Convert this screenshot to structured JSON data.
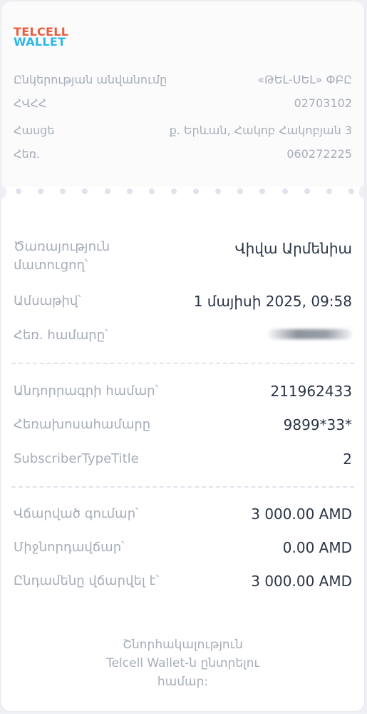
{
  "brand": {
    "line1": "TELCELL",
    "line2": "WALLET"
  },
  "company": [
    {
      "label": "Ընկերության անվանումը",
      "value": "«ԹԵԼ-ՍԵԼ» ՓԲԸ"
    },
    {
      "label": "ՀՎՀՀ",
      "value": "02703102"
    },
    {
      "label": "Հասցե",
      "value": "ք. Երևան, Հակոբ Հակոբյան 3"
    },
    {
      "label": "Հեռ.",
      "value": "060272225"
    }
  ],
  "provider": {
    "label_line1": "Ծառայություն",
    "label_line2": "մատուցող՝",
    "value": "Վիվա Արմենիա"
  },
  "date": {
    "label": "Ամսաթիվ՝",
    "value": "1 մայիսի 2025, 09:58"
  },
  "phone": {
    "label": "Հեռ. համարը՝"
  },
  "details": [
    {
      "label": "Անդորրագրի համար՝",
      "value": "211962433"
    },
    {
      "label": "Հեռախոսահամարը",
      "value": "9899*33*"
    },
    {
      "label": "SubscriberTypeTitle",
      "value": "2"
    }
  ],
  "payment": [
    {
      "label": "Վճարված գումար՝",
      "value": "3 000.00 AMD"
    },
    {
      "label": "Միջնորդավճար՝",
      "value": "0.00 AMD"
    },
    {
      "label": "Ընդամենը վճարվել է՝",
      "value": "3 000.00 AMD"
    }
  ],
  "thanks": {
    "line1": "Շնորհակալություն",
    "line2": "Telcell Wallet-ն ընտրելու",
    "line3": "համար:"
  },
  "colors": {
    "brand_red": "#ef5a3c",
    "brand_blue": "#2bb7e8",
    "text_dark": "#2a3446",
    "text_muted": "#a6adb8"
  }
}
